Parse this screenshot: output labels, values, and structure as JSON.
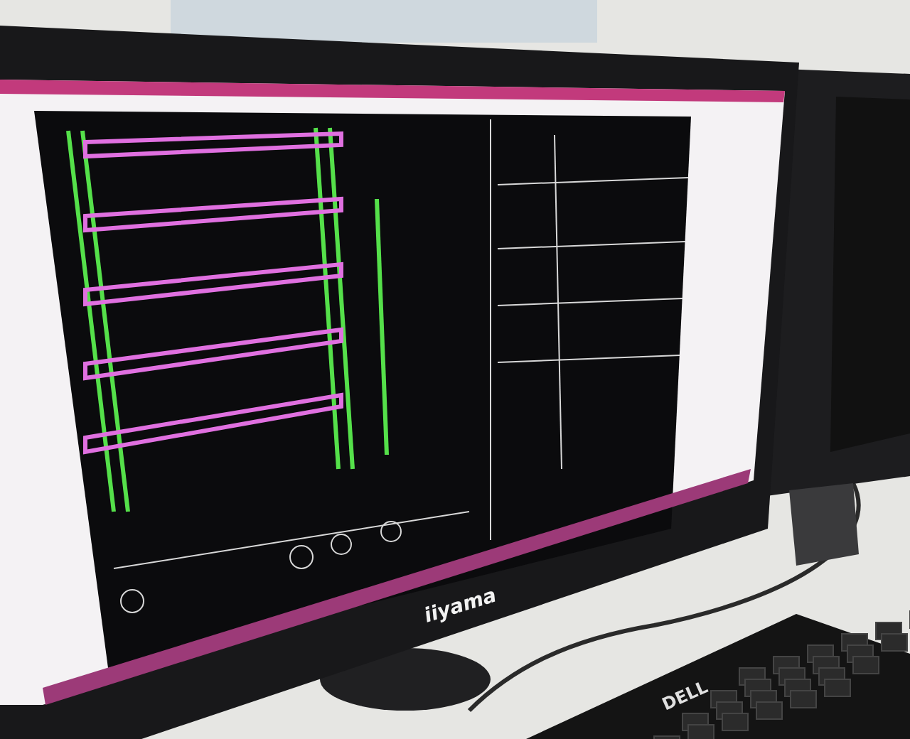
{
  "monitor_brand": "iiyama",
  "keyboard_brand": "DELL"
}
